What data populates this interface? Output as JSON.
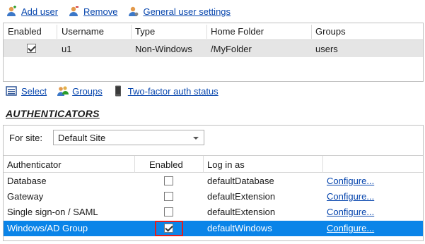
{
  "toolbar": {
    "add_user": "Add user",
    "remove": "Remove",
    "general_user_settings": "General user settings"
  },
  "users_table": {
    "columns": [
      "Enabled",
      "Username",
      "Type",
      "Home Folder",
      "Groups"
    ],
    "rows": [
      {
        "enabled": true,
        "username": "u1",
        "type": "Non-Windows",
        "home_folder": "/MyFolder",
        "groups": "users"
      }
    ]
  },
  "secondary_toolbar": {
    "select": "Select",
    "groups": "Groups",
    "two_factor": "Two-factor auth status"
  },
  "authenticators": {
    "heading": "AUTHENTICATORS",
    "for_site_label": "For site:",
    "site_value": "Default Site",
    "columns": [
      "Authenticator",
      "Enabled",
      "Log in as"
    ],
    "rows": [
      {
        "name": "Database",
        "enabled": false,
        "login_as": "defaultDatabase",
        "action": "Configure..."
      },
      {
        "name": "Gateway",
        "enabled": false,
        "login_as": "defaultExtension",
        "action": "Configure..."
      },
      {
        "name": "Single sign-on / SAML",
        "enabled": false,
        "login_as": "defaultExtension",
        "action": "Configure..."
      },
      {
        "name": "Windows/AD Group",
        "enabled": true,
        "login_as": "defaultWindows",
        "action": "Configure...",
        "selected": true
      }
    ]
  },
  "colors": {
    "link": "#0645ad",
    "selection": "#0a84e8",
    "highlight": "#e01f1f",
    "row_gray": "#e5e5e5"
  }
}
